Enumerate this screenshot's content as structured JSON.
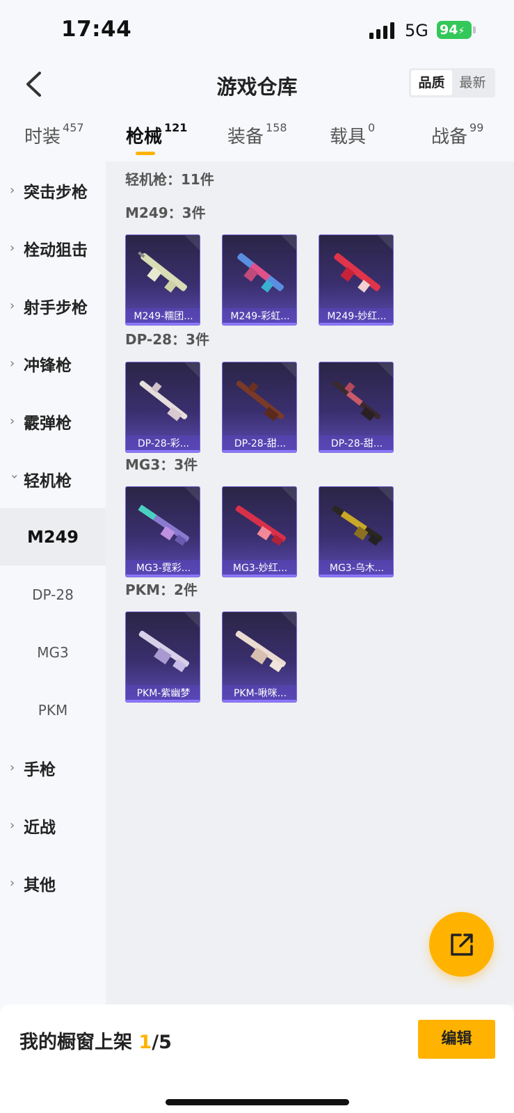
{
  "status": {
    "time": "17:44",
    "network": "5G",
    "battery": "94"
  },
  "header": {
    "title": "游戏仓库",
    "sort_options": [
      "品质",
      "最新"
    ],
    "sort_active": 0
  },
  "tabs": [
    {
      "label": "时装",
      "count": "457"
    },
    {
      "label": "枪械",
      "count": "121"
    },
    {
      "label": "装备",
      "count": "158"
    },
    {
      "label": "载具",
      "count": "0"
    },
    {
      "label": "战备",
      "count": "99"
    }
  ],
  "sidebar": {
    "items": [
      {
        "label": "突击步枪"
      },
      {
        "label": "栓动狙击"
      },
      {
        "label": "射手步枪"
      },
      {
        "label": "冲锋枪"
      },
      {
        "label": "霰弹枪"
      },
      {
        "label": "轻机枪"
      },
      {
        "label": "手枪"
      },
      {
        "label": "近战"
      },
      {
        "label": "其他"
      }
    ],
    "subitems": [
      {
        "label": "M249"
      },
      {
        "label": "DP-28"
      },
      {
        "label": "MG3"
      },
      {
        "label": "PKM"
      }
    ]
  },
  "main": {
    "summary": "轻机枪：11件",
    "groups": [
      {
        "title": "M249：3件",
        "items": [
          "M249-糯团...",
          "M249-彩虹...",
          "M249-妙红..."
        ]
      },
      {
        "title": "DP-28：3件",
        "items": [
          "DP-28-彩...",
          "DP-28-甜...",
          "DP-28-甜..."
        ]
      },
      {
        "title": "MG3：3件",
        "items": [
          "MG3-霓彩...",
          "MG3-妙红...",
          "MG3-乌木..."
        ]
      },
      {
        "title": "PKM：2件",
        "items": [
          "PKM-紫幽梦",
          "PKM-啾咪..."
        ]
      }
    ]
  },
  "bottom": {
    "prefix": "我的橱窗上架 ",
    "current": "1",
    "total": "/5",
    "edit_label": "编辑"
  },
  "colors": {
    "accent": "#ffb300",
    "card_bg": "#3a2f6e",
    "card_border": "#7a68d8",
    "battery": "#34c759"
  },
  "icons": [
    "back-icon",
    "share-icon",
    "chevron-right-icon",
    "chevron-down-icon",
    "signal-icon",
    "battery-icon"
  ]
}
